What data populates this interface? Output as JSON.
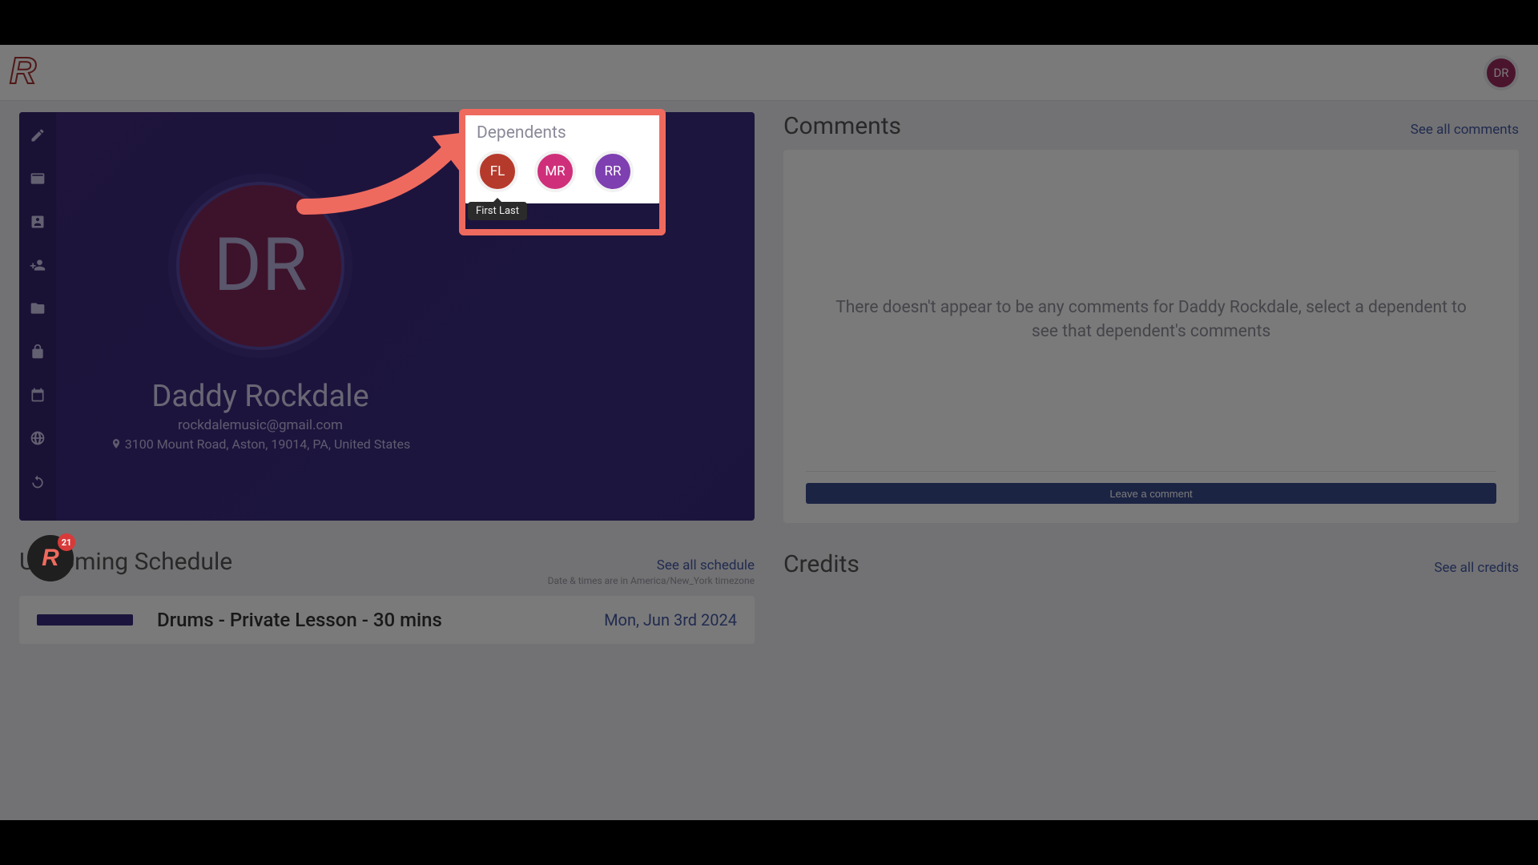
{
  "header": {
    "avatar_initials": "DR"
  },
  "profile": {
    "avatar_initials": "DR",
    "name": "Daddy Rockdale",
    "email": "rockdalemusic@gmail.com",
    "address": "3100 Mount Road, Aston, 19014, PA, United States"
  },
  "dependents": {
    "title": "Dependents",
    "items": [
      {
        "initials": "FL",
        "name": "First Last"
      },
      {
        "initials": "MR",
        "name": ""
      },
      {
        "initials": "RR",
        "name": ""
      }
    ],
    "tooltip": "First Last"
  },
  "comments": {
    "title": "Comments",
    "see_all": "See all comments",
    "empty_text": "There doesn't appear to be any comments for Daddy Rockdale, select a dependent to see that dependent's comments",
    "button": "Leave a comment"
  },
  "schedule": {
    "title": "Upcoming Schedule",
    "see_all": "See all schedule",
    "tz_note": "Date & times are in America/New_York timezone",
    "item": {
      "title": "Drums - Private Lesson - 30 mins",
      "date": "Mon, Jun 3rd 2024"
    }
  },
  "credits": {
    "title": "Credits",
    "see_all": "See all credits"
  },
  "float_badge": {
    "count": "21"
  }
}
